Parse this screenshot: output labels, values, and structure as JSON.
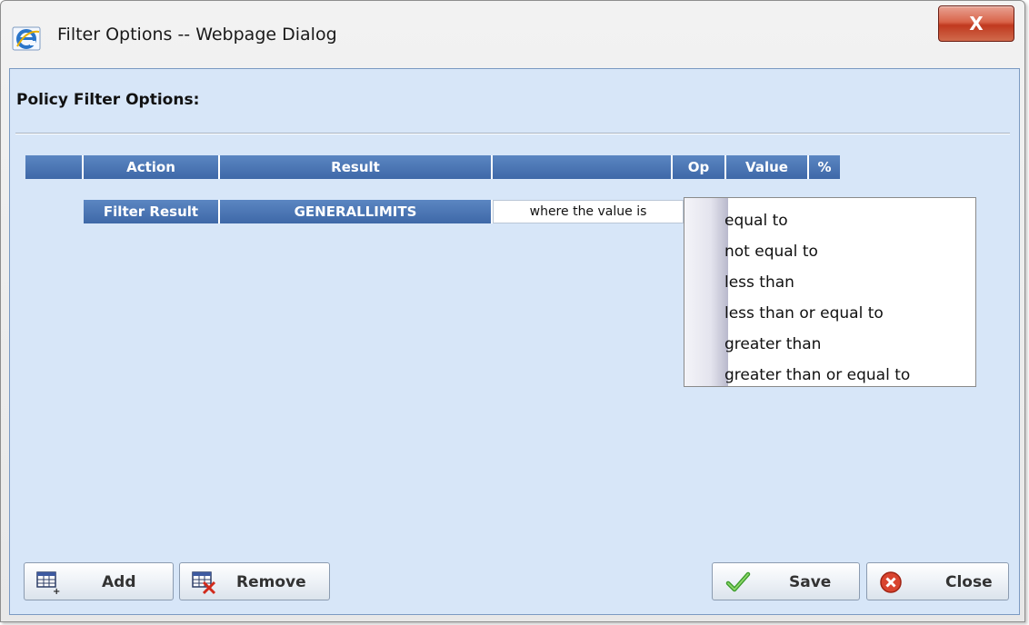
{
  "window": {
    "title": "Filter Options -- Webpage Dialog",
    "close_glyph": "X",
    "icons": {
      "app": "internet-explorer-icon",
      "close": "close-icon"
    }
  },
  "panel": {
    "heading": "Policy Filter Options:"
  },
  "table": {
    "headers": [
      "",
      "Action",
      "Result",
      "",
      "Op",
      "Value",
      "%"
    ],
    "row": {
      "action": "Filter Result",
      "result": "GENERALLIMITS",
      "condition": "where the value is"
    }
  },
  "op_dropdown": {
    "options": [
      "equal to",
      "not equal to",
      "less than",
      "less than or equal to",
      "greater than",
      "greater than or equal to"
    ]
  },
  "buttons": {
    "add": {
      "label": "Add",
      "icon": "add-row-icon"
    },
    "remove": {
      "label": "Remove",
      "icon": "remove-row-icon"
    },
    "save": {
      "label": "Save",
      "icon": "checkmark-icon"
    },
    "close": {
      "label": "Close",
      "icon": "close-circle-icon"
    }
  },
  "colors": {
    "panel_bg": "#d7e6f8",
    "header_blue": "#4a74b4",
    "close_red": "#c0391f"
  }
}
